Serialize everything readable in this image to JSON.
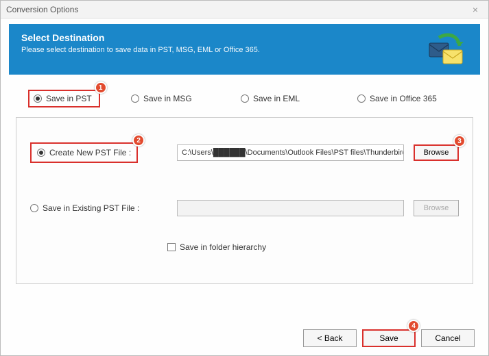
{
  "window": {
    "title": "Conversion Options"
  },
  "banner": {
    "heading": "Select Destination",
    "sub": "Please select destination to save data in PST, MSG, EML or Office 365."
  },
  "formats": {
    "pst": "Save in PST",
    "msg": "Save in MSG",
    "eml": "Save in EML",
    "office365": "Save in Office 365",
    "selected": "pst"
  },
  "pst": {
    "create_label": "Create New PST File :",
    "create_path": "C:\\Users\\██████\\Documents\\Outlook Files\\PST files\\Thunderbird",
    "existing_label": "Save in Existing PST File :",
    "existing_path": "",
    "selected": "create",
    "browse_label": "Browse"
  },
  "checkbox": {
    "folder_hierarchy": "Save in folder hierarchy",
    "checked": false
  },
  "footer": {
    "back": "< Back",
    "save": "Save",
    "cancel": "Cancel"
  },
  "callouts": {
    "1": "1",
    "2": "2",
    "3": "3",
    "4": "4"
  }
}
